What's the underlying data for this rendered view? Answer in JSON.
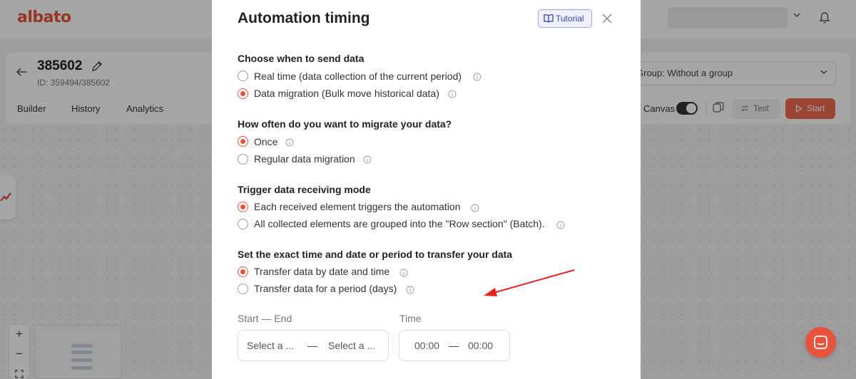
{
  "app": {
    "logo": "albato"
  },
  "automation": {
    "name": "385602",
    "id_line": "ID: 359494/385602"
  },
  "tabs": [
    "Builder",
    "History",
    "Analytics"
  ],
  "toolbar": {
    "group_label": "Group: Without a group",
    "canvas_label": "Canvas",
    "canvas_toggle_on": true,
    "test_label": "Test",
    "start_label": "Start"
  },
  "modal": {
    "title": "Automation timing",
    "tutorial_label": "Tutorial",
    "sections": [
      {
        "title": "Choose when to send data",
        "options": [
          {
            "label": "Real time (data collection of the current period)",
            "checked": false
          },
          {
            "label": "Data migration (Bulk move historical data)",
            "checked": true
          }
        ]
      },
      {
        "title": "How often do you want to migrate your data?",
        "options": [
          {
            "label": "Once",
            "checked": true
          },
          {
            "label": "Regular data migration",
            "checked": false
          }
        ]
      },
      {
        "title": "Trigger data receiving mode",
        "options": [
          {
            "label": "Each received element triggers the automation",
            "checked": true
          },
          {
            "label": "All collected elements are grouped into the \"Row section\" (Batch).",
            "checked": false
          }
        ]
      },
      {
        "title": "Set the exact time and date or period to transfer your data",
        "options": [
          {
            "label": "Transfer data by date and time",
            "checked": true
          },
          {
            "label": "Transfer data for a period (days)",
            "checked": false
          }
        ]
      }
    ],
    "date_range": {
      "label": "Start — End",
      "start_placeholder": "Select a ...",
      "end_placeholder": "Select a ...",
      "separator": "—"
    },
    "time_range": {
      "label": "Time",
      "start": "00:00",
      "end": "00:00",
      "separator": "—"
    }
  },
  "colors": {
    "accent": "#e9533b",
    "tutorial": "#3a46a8",
    "annotation_arrow": "#e8231f"
  }
}
